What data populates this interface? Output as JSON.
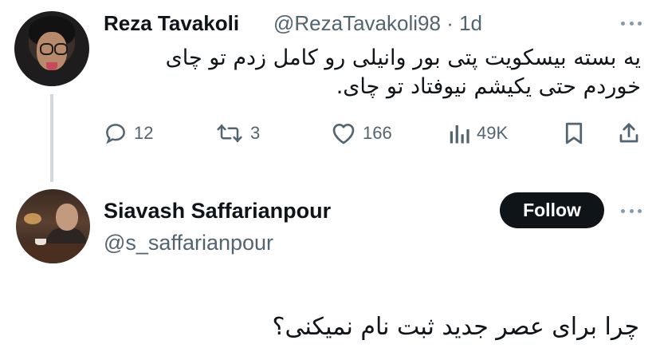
{
  "tweet": {
    "author_name": "Reza Tavakoli",
    "author_handle": "@RezaTavakoli98",
    "separator": "·",
    "time": "1d",
    "text_line1": "یه بسته بیسکویت پتی بور وانیلی رو کامل زدم تو چای",
    "text_line2": "خوردم حتی یکیشم نیوفتاد تو چای.",
    "actions": {
      "reply_icon": "reply-icon",
      "replies": "12",
      "retweet_icon": "retweet-icon",
      "retweets": "3",
      "like_icon": "heart-icon",
      "likes": "166",
      "views_icon": "views-bar-chart-icon",
      "views": "49K",
      "bookmark_icon": "bookmark-icon",
      "share_icon": "share-icon"
    }
  },
  "reply": {
    "author_name": "Siavash Saffarianpour",
    "author_handle": "@s_saffarianpour",
    "follow_label": "Follow",
    "text": "چرا برای عصر جدید ثبت نام نمیکنی؟"
  },
  "colors": {
    "text_primary": "#0f1419",
    "text_secondary": "#536471",
    "thread_line": "#cfd9de",
    "follow_bg": "#0f1419",
    "follow_text": "#ffffff"
  }
}
